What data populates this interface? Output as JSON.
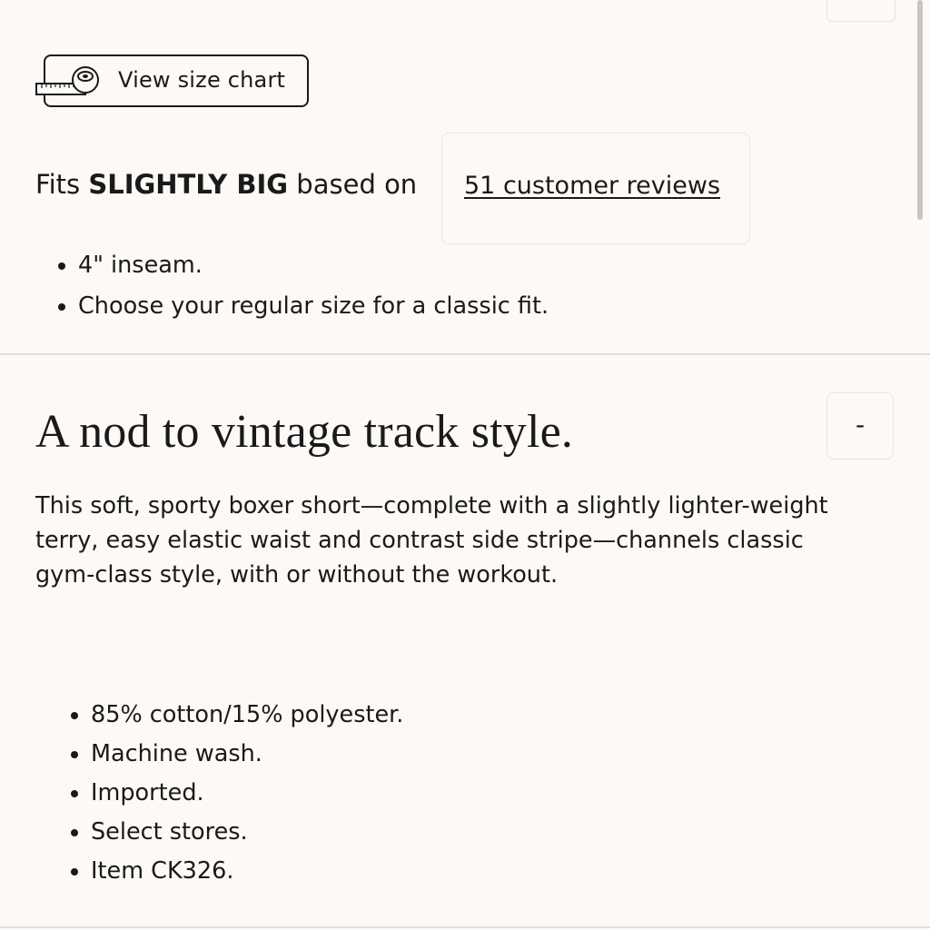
{
  "size_chart": {
    "label": "View size chart",
    "icon": "measuring-tape-icon"
  },
  "fit": {
    "prefix": "Fits ",
    "rating": "SLIGHTLY BIG",
    "suffix": " based on",
    "reviews_link": "51 customer reviews"
  },
  "fit_notes": [
    "4\" inseam.",
    "Choose your regular size for a classic fit."
  ],
  "product": {
    "heading": "A nod to vintage track style.",
    "collapse_label": "-",
    "description": "This soft, sporty boxer short—complete with a slightly lighter-weight terry, easy elastic waist and contrast side stripe—channels classic gym-class style, with or without the workout.",
    "details": [
      "85% cotton/15% polyester.",
      "Machine wash.",
      "Imported.",
      "Select stores.",
      "Item CK326."
    ]
  },
  "colors": {
    "background": "#fcf9f6",
    "text": "#1a1a1a",
    "border": "#e8e4e0"
  }
}
